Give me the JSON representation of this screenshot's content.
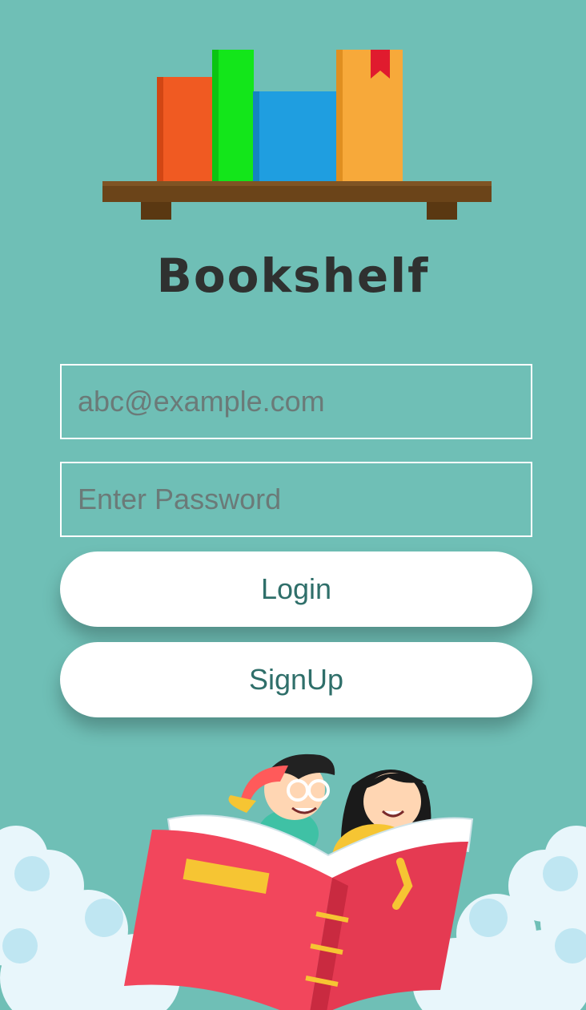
{
  "app": {
    "title": "Bookshelf"
  },
  "form": {
    "email_placeholder": "abc@example.com",
    "password_placeholder": "Enter Password"
  },
  "buttons": {
    "login": "Login",
    "signup": "SignUp"
  },
  "colors": {
    "background": "#6fbfb6",
    "button_text": "#2f6f6a",
    "title_text": "#2f3130",
    "book_orange": "#f05a22",
    "book_green": "#13e61a",
    "book_blue": "#1f9ee0",
    "book_yellow": "#f7a93a",
    "shelf_brown": "#6b4419"
  },
  "icons": {
    "logo": "bookshelf-logo-icon",
    "illustration": "kids-reading-book-illustration"
  }
}
